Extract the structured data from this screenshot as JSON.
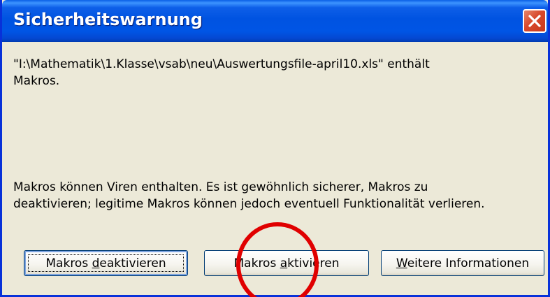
{
  "dialog": {
    "title": "Sicherheitswarnung",
    "message_line1": "\"I:\\Mathematik\\1.Klasse\\vsab\\neu\\Auswertungsfile-april10.xls\" enthält",
    "message_line2": "Makros.",
    "warning_line1": "Makros können Viren enthalten. Es ist gewöhnlich sicherer, Makros zu",
    "warning_line2": "deaktivieren; legitime Makros können jedoch eventuell Funktionalität verlieren."
  },
  "buttons": {
    "deactivate": {
      "pre": "Makros ",
      "accel": "d",
      "post": "eaktivieren"
    },
    "activate": {
      "pre": "Makros ",
      "accel": "a",
      "post": "ktivieren"
    },
    "more_info": {
      "pre": "",
      "accel": "W",
      "post": "eitere Informationen"
    }
  },
  "icons": {
    "close": "close-icon"
  },
  "colors": {
    "title_bar": "#0054E3",
    "window_border": "#0831D9",
    "dialog_background": "#ECE9D8",
    "close_button": "#D8492C",
    "annotation_circle": "#E00000"
  }
}
